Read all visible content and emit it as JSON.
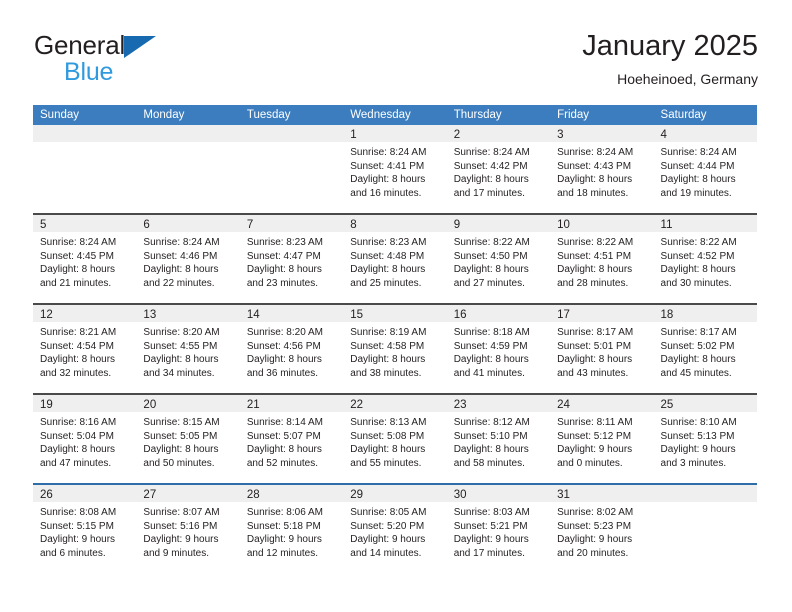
{
  "brand": {
    "name_dark": "General",
    "name_light": "Blue"
  },
  "header": {
    "title": "January 2025",
    "subtitle": "Hoeheinoed, Germany"
  },
  "colors": {
    "header_blue": "#3b7dbf",
    "row_separator_blue": "#2f6da8",
    "row_separator_dark": "#4a4a4a",
    "day_band_gray": "#efefef",
    "brand_triangle_blue": "#1769b0",
    "brand_text_blue": "#2f9ade",
    "text": "#231f20"
  },
  "weekday_headers": [
    "Sunday",
    "Monday",
    "Tuesday",
    "Wednesday",
    "Thursday",
    "Friday",
    "Saturday"
  ],
  "weeks": [
    [
      {
        "day": "",
        "sunrise": "",
        "sunset": "",
        "daylight_1": "",
        "daylight_2": ""
      },
      {
        "day": "",
        "sunrise": "",
        "sunset": "",
        "daylight_1": "",
        "daylight_2": ""
      },
      {
        "day": "",
        "sunrise": "",
        "sunset": "",
        "daylight_1": "",
        "daylight_2": ""
      },
      {
        "day": "1",
        "sunrise": "Sunrise: 8:24 AM",
        "sunset": "Sunset: 4:41 PM",
        "daylight_1": "Daylight: 8 hours",
        "daylight_2": "and 16 minutes."
      },
      {
        "day": "2",
        "sunrise": "Sunrise: 8:24 AM",
        "sunset": "Sunset: 4:42 PM",
        "daylight_1": "Daylight: 8 hours",
        "daylight_2": "and 17 minutes."
      },
      {
        "day": "3",
        "sunrise": "Sunrise: 8:24 AM",
        "sunset": "Sunset: 4:43 PM",
        "daylight_1": "Daylight: 8 hours",
        "daylight_2": "and 18 minutes."
      },
      {
        "day": "4",
        "sunrise": "Sunrise: 8:24 AM",
        "sunset": "Sunset: 4:44 PM",
        "daylight_1": "Daylight: 8 hours",
        "daylight_2": "and 19 minutes."
      }
    ],
    [
      {
        "day": "5",
        "sunrise": "Sunrise: 8:24 AM",
        "sunset": "Sunset: 4:45 PM",
        "daylight_1": "Daylight: 8 hours",
        "daylight_2": "and 21 minutes."
      },
      {
        "day": "6",
        "sunrise": "Sunrise: 8:24 AM",
        "sunset": "Sunset: 4:46 PM",
        "daylight_1": "Daylight: 8 hours",
        "daylight_2": "and 22 minutes."
      },
      {
        "day": "7",
        "sunrise": "Sunrise: 8:23 AM",
        "sunset": "Sunset: 4:47 PM",
        "daylight_1": "Daylight: 8 hours",
        "daylight_2": "and 23 minutes."
      },
      {
        "day": "8",
        "sunrise": "Sunrise: 8:23 AM",
        "sunset": "Sunset: 4:48 PM",
        "daylight_1": "Daylight: 8 hours",
        "daylight_2": "and 25 minutes."
      },
      {
        "day": "9",
        "sunrise": "Sunrise: 8:22 AM",
        "sunset": "Sunset: 4:50 PM",
        "daylight_1": "Daylight: 8 hours",
        "daylight_2": "and 27 minutes."
      },
      {
        "day": "10",
        "sunrise": "Sunrise: 8:22 AM",
        "sunset": "Sunset: 4:51 PM",
        "daylight_1": "Daylight: 8 hours",
        "daylight_2": "and 28 minutes."
      },
      {
        "day": "11",
        "sunrise": "Sunrise: 8:22 AM",
        "sunset": "Sunset: 4:52 PM",
        "daylight_1": "Daylight: 8 hours",
        "daylight_2": "and 30 minutes."
      }
    ],
    [
      {
        "day": "12",
        "sunrise": "Sunrise: 8:21 AM",
        "sunset": "Sunset: 4:54 PM",
        "daylight_1": "Daylight: 8 hours",
        "daylight_2": "and 32 minutes."
      },
      {
        "day": "13",
        "sunrise": "Sunrise: 8:20 AM",
        "sunset": "Sunset: 4:55 PM",
        "daylight_1": "Daylight: 8 hours",
        "daylight_2": "and 34 minutes."
      },
      {
        "day": "14",
        "sunrise": "Sunrise: 8:20 AM",
        "sunset": "Sunset: 4:56 PM",
        "daylight_1": "Daylight: 8 hours",
        "daylight_2": "and 36 minutes."
      },
      {
        "day": "15",
        "sunrise": "Sunrise: 8:19 AM",
        "sunset": "Sunset: 4:58 PM",
        "daylight_1": "Daylight: 8 hours",
        "daylight_2": "and 38 minutes."
      },
      {
        "day": "16",
        "sunrise": "Sunrise: 8:18 AM",
        "sunset": "Sunset: 4:59 PM",
        "daylight_1": "Daylight: 8 hours",
        "daylight_2": "and 41 minutes."
      },
      {
        "day": "17",
        "sunrise": "Sunrise: 8:17 AM",
        "sunset": "Sunset: 5:01 PM",
        "daylight_1": "Daylight: 8 hours",
        "daylight_2": "and 43 minutes."
      },
      {
        "day": "18",
        "sunrise": "Sunrise: 8:17 AM",
        "sunset": "Sunset: 5:02 PM",
        "daylight_1": "Daylight: 8 hours",
        "daylight_2": "and 45 minutes."
      }
    ],
    [
      {
        "day": "19",
        "sunrise": "Sunrise: 8:16 AM",
        "sunset": "Sunset: 5:04 PM",
        "daylight_1": "Daylight: 8 hours",
        "daylight_2": "and 47 minutes."
      },
      {
        "day": "20",
        "sunrise": "Sunrise: 8:15 AM",
        "sunset": "Sunset: 5:05 PM",
        "daylight_1": "Daylight: 8 hours",
        "daylight_2": "and 50 minutes."
      },
      {
        "day": "21",
        "sunrise": "Sunrise: 8:14 AM",
        "sunset": "Sunset: 5:07 PM",
        "daylight_1": "Daylight: 8 hours",
        "daylight_2": "and 52 minutes."
      },
      {
        "day": "22",
        "sunrise": "Sunrise: 8:13 AM",
        "sunset": "Sunset: 5:08 PM",
        "daylight_1": "Daylight: 8 hours",
        "daylight_2": "and 55 minutes."
      },
      {
        "day": "23",
        "sunrise": "Sunrise: 8:12 AM",
        "sunset": "Sunset: 5:10 PM",
        "daylight_1": "Daylight: 8 hours",
        "daylight_2": "and 58 minutes."
      },
      {
        "day": "24",
        "sunrise": "Sunrise: 8:11 AM",
        "sunset": "Sunset: 5:12 PM",
        "daylight_1": "Daylight: 9 hours",
        "daylight_2": "and 0 minutes."
      },
      {
        "day": "25",
        "sunrise": "Sunrise: 8:10 AM",
        "sunset": "Sunset: 5:13 PM",
        "daylight_1": "Daylight: 9 hours",
        "daylight_2": "and 3 minutes."
      }
    ],
    [
      {
        "day": "26",
        "sunrise": "Sunrise: 8:08 AM",
        "sunset": "Sunset: 5:15 PM",
        "daylight_1": "Daylight: 9 hours",
        "daylight_2": "and 6 minutes."
      },
      {
        "day": "27",
        "sunrise": "Sunrise: 8:07 AM",
        "sunset": "Sunset: 5:16 PM",
        "daylight_1": "Daylight: 9 hours",
        "daylight_2": "and 9 minutes."
      },
      {
        "day": "28",
        "sunrise": "Sunrise: 8:06 AM",
        "sunset": "Sunset: 5:18 PM",
        "daylight_1": "Daylight: 9 hours",
        "daylight_2": "and 12 minutes."
      },
      {
        "day": "29",
        "sunrise": "Sunrise: 8:05 AM",
        "sunset": "Sunset: 5:20 PM",
        "daylight_1": "Daylight: 9 hours",
        "daylight_2": "and 14 minutes."
      },
      {
        "day": "30",
        "sunrise": "Sunrise: 8:03 AM",
        "sunset": "Sunset: 5:21 PM",
        "daylight_1": "Daylight: 9 hours",
        "daylight_2": "and 17 minutes."
      },
      {
        "day": "31",
        "sunrise": "Sunrise: 8:02 AM",
        "sunset": "Sunset: 5:23 PM",
        "daylight_1": "Daylight: 9 hours",
        "daylight_2": "and 20 minutes."
      },
      {
        "day": "",
        "sunrise": "",
        "sunset": "",
        "daylight_1": "",
        "daylight_2": ""
      }
    ]
  ]
}
